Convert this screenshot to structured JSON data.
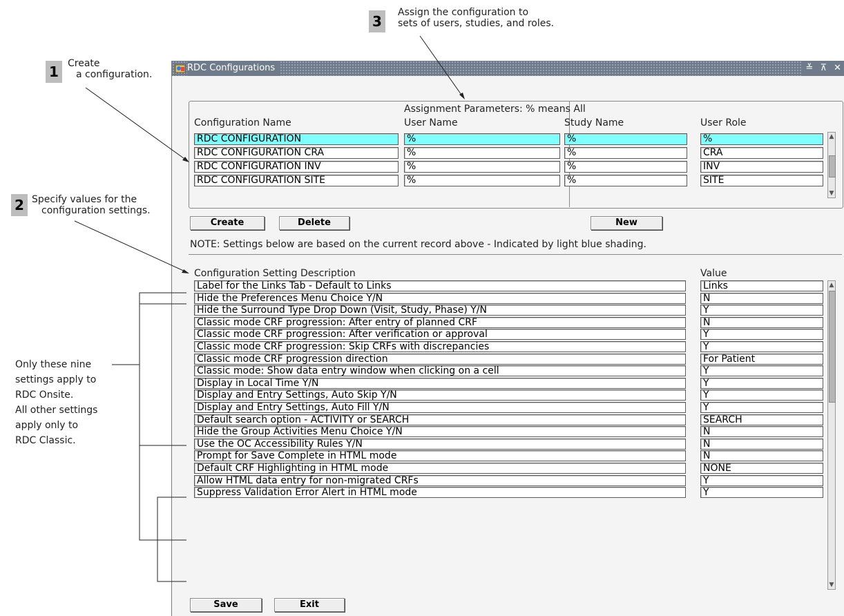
{
  "callouts": [
    {
      "num": "1",
      "text_line1": "Create",
      "text_line2": "a configuration."
    },
    {
      "num": "2",
      "text_line1": "Specify values for the",
      "text_line2": "configuration settings."
    },
    {
      "num": "3",
      "text_line1": "Assign the configuration to",
      "text_line2": "sets of users, studies, and roles."
    }
  ],
  "side_notes": {
    "line1": "Only these nine",
    "line2": "settings apply to",
    "line3": "RDC Onsite.",
    "line4": "All other settings",
    "line5": "apply only to",
    "line6": "RDC Classic."
  },
  "window": {
    "title": "RDC Configurations",
    "controls": "≚ ⊼ ✕",
    "title_bar_color": "#6f7a8a"
  },
  "config_table": {
    "group_header": "Assignment Parameters:  % means All",
    "col_config": "Configuration Name",
    "col_user": "User Name",
    "col_study": "Study Name",
    "col_role": "User Role",
    "selected_color": "#80ffff",
    "rows": [
      {
        "name": "RDC CONFIGURATION",
        "user": "%",
        "study": "%",
        "role": "%"
      },
      {
        "name": "RDC CONFIGURATION  CRA",
        "user": "%",
        "study": "%",
        "role": "CRA"
      },
      {
        "name": "RDC CONFIGURATION  INV",
        "user": "%",
        "study": "%",
        "role": "INV"
      },
      {
        "name": "RDC CONFIGURATION  SITE",
        "user": "%",
        "study": "%",
        "role": "SITE"
      }
    ]
  },
  "buttons": {
    "create": "Create",
    "delete": "Delete",
    "new": "New",
    "save": "Save",
    "exit": "Exit"
  },
  "note": "NOTE:  Settings below are based on the current record above - Indicated by light blue shading.",
  "settings": {
    "col_desc": "Configuration Setting Description",
    "col_value": "Value",
    "rows": [
      {
        "desc": "Label for the Links Tab - Default to Links",
        "value": "Links"
      },
      {
        "desc": "Hide the Preferences Menu Choice Y/N",
        "value": "N"
      },
      {
        "desc": "Hide the Surround Type Drop Down (Visit, Study, Phase) Y/N",
        "value": "Y"
      },
      {
        "desc": "Classic mode CRF progression: After entry of planned CRF",
        "value": "N"
      },
      {
        "desc": "Classic mode CRF progression: After verification or approval",
        "value": "Y"
      },
      {
        "desc": "Classic mode CRF progression: Skip CRFs with discrepancies",
        "value": "Y"
      },
      {
        "desc": "Classic mode CRF progression direction",
        "value": "For Patient"
      },
      {
        "desc": "Classic mode: Show data entry window when clicking on a cell",
        "value": "Y"
      },
      {
        "desc": "Display in Local Time Y/N",
        "value": "Y"
      },
      {
        "desc": "Display and Entry Settings, Auto Skip Y/N",
        "value": "Y"
      },
      {
        "desc": "Display and Entry Settings, Auto Fill Y/N",
        "value": "Y"
      },
      {
        "desc": "Default search option - ACTIVITY or SEARCH",
        "value": "SEARCH"
      },
      {
        "desc": "Hide the Group Activities Menu Choice Y/N",
        "value": "N"
      },
      {
        "desc": "Use the OC Accessibility Rules Y/N",
        "value": "N"
      },
      {
        "desc": "Prompt for Save Complete in HTML mode",
        "value": "N"
      },
      {
        "desc": "Default CRF Highlighting in HTML mode",
        "value": "NONE"
      },
      {
        "desc": "Allow HTML data entry for non-migrated CRFs",
        "value": "Y"
      },
      {
        "desc": "Suppress Validation Error Alert in HTML mode",
        "value": "Y"
      }
    ]
  },
  "icons": {
    "window_icon": "app-icon",
    "scroll_up": "scroll-up-icon",
    "scroll_down": "scroll-down-icon"
  }
}
